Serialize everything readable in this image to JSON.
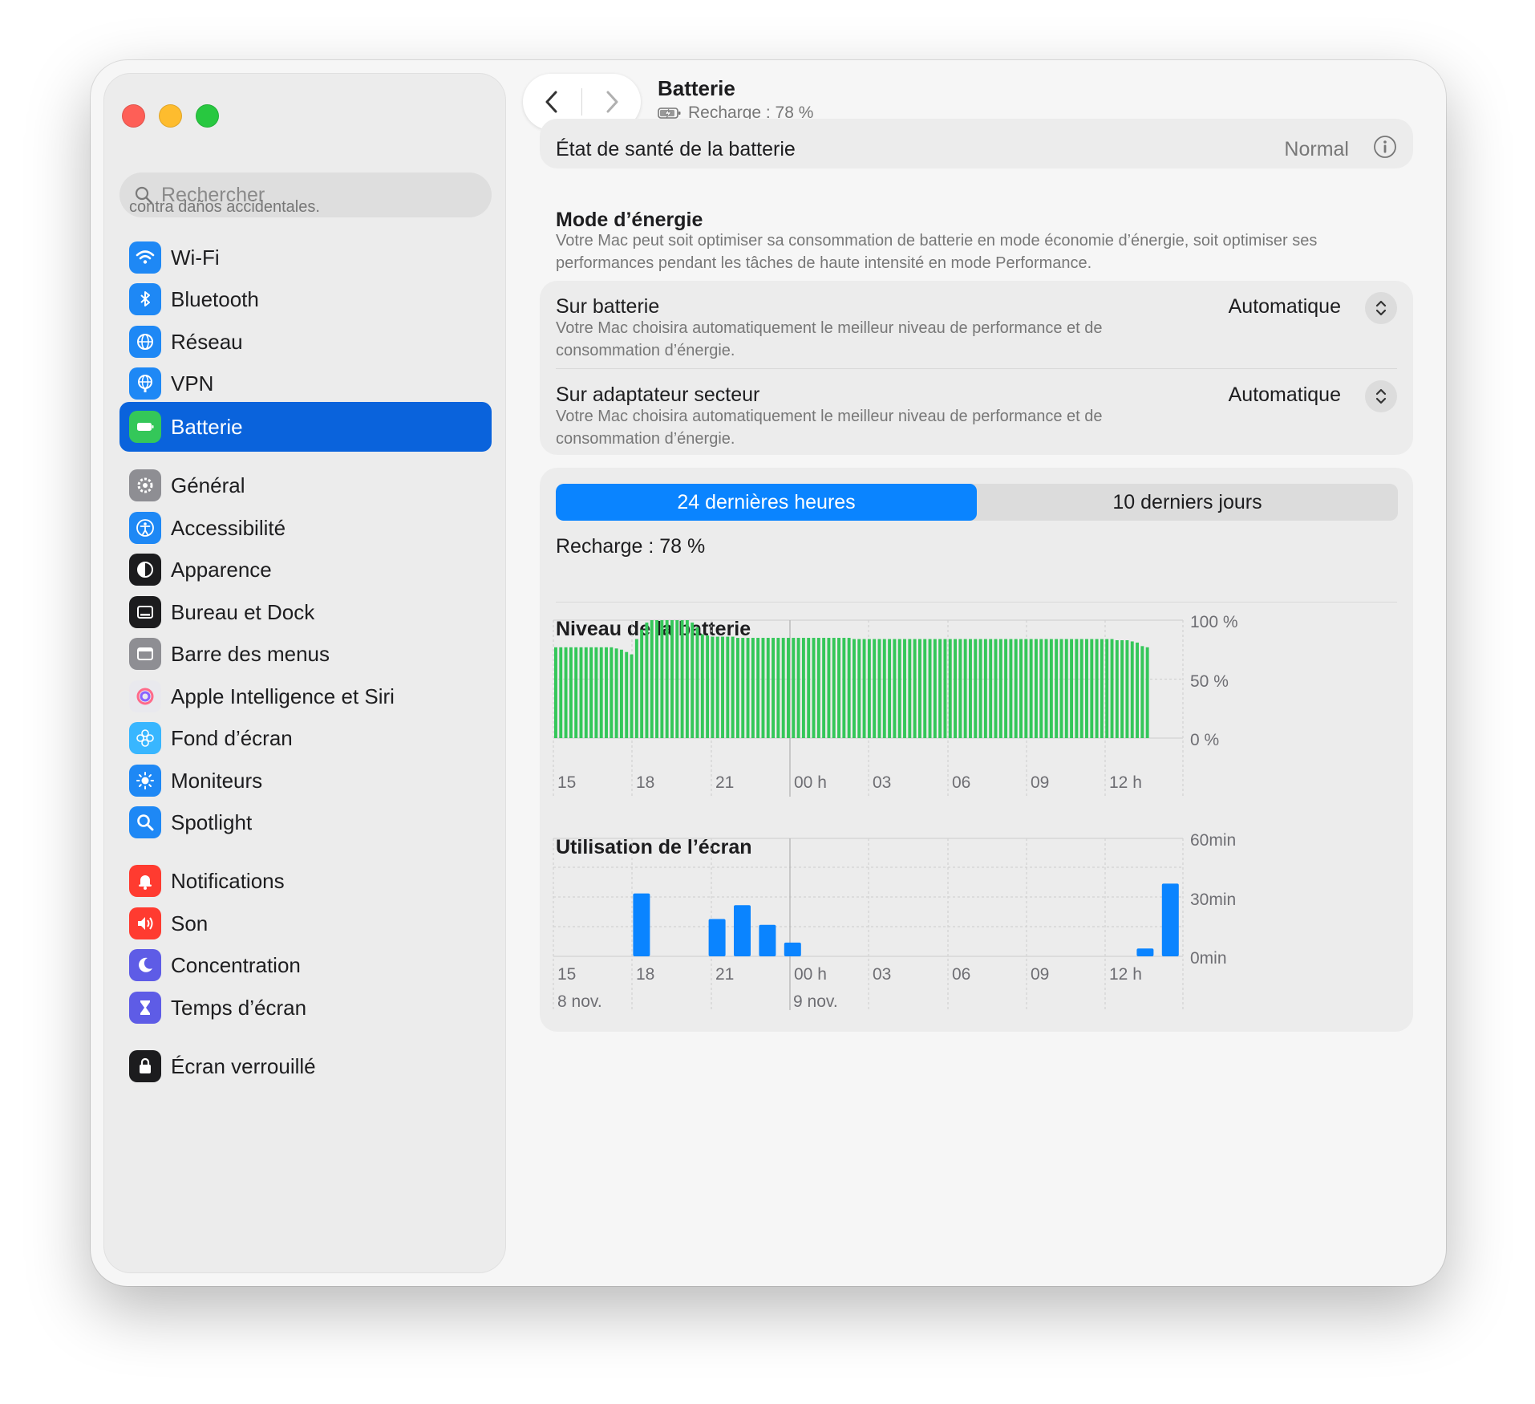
{
  "sidebar": {
    "search_placeholder": "Rechercher",
    "ghost_text": "contra daños accidentales.",
    "items": [
      {
        "label": "Wi-Fi",
        "icon": "wifi-icon",
        "color": "#1e88f5"
      },
      {
        "label": "Bluetooth",
        "icon": "bluetooth-icon",
        "color": "#1e88f5"
      },
      {
        "label": "Réseau",
        "icon": "globe-icon",
        "color": "#1e88f5"
      },
      {
        "label": "VPN",
        "icon": "vpn-globe-icon",
        "color": "#1e88f5"
      },
      {
        "label": "Batterie",
        "icon": "battery-icon",
        "color": "#34c759",
        "active": true
      },
      {
        "label": "Général",
        "icon": "gear-icon",
        "color": "#8e8e93"
      },
      {
        "label": "Accessibilité",
        "icon": "accessibility-icon",
        "color": "#1e88f5"
      },
      {
        "label": "Apparence",
        "icon": "appearance-icon",
        "color": "#1c1c1e"
      },
      {
        "label": "Bureau et Dock",
        "icon": "dock-icon",
        "color": "#1c1c1e"
      },
      {
        "label": "Barre des menus",
        "icon": "menubar-icon",
        "color": "#8e8e93"
      },
      {
        "label": "Apple Intelligence et Siri",
        "icon": "siri-icon",
        "color": "#e9e9ee"
      },
      {
        "label": "Fond d’écran",
        "icon": "flower-icon",
        "color": "#38b6ff"
      },
      {
        "label": "Moniteurs",
        "icon": "sun-icon",
        "color": "#1e88f5"
      },
      {
        "label": "Spotlight",
        "icon": "magnifier-icon",
        "color": "#1e88f5"
      },
      {
        "label": "Notifications",
        "icon": "bell-icon",
        "color": "#ff3b30"
      },
      {
        "label": "Son",
        "icon": "speaker-icon",
        "color": "#ff3b30"
      },
      {
        "label": "Concentration",
        "icon": "moon-icon",
        "color": "#5e5ce6"
      },
      {
        "label": "Temps d’écran",
        "icon": "hourglass-icon",
        "color": "#5e5ce6"
      },
      {
        "label": "Écran verrouillé",
        "icon": "lock-icon",
        "color": "#1c1c1e"
      }
    ]
  },
  "header": {
    "title": "Batterie",
    "subtitle": "Recharge : 78 %"
  },
  "health": {
    "label": "État de santé de la batterie",
    "value": "Normal"
  },
  "energy": {
    "title": "Mode d’énergie",
    "description": "Votre Mac peut soit optimiser sa consommation de batterie en mode économie d’énergie, soit optimiser ses performances pendant les tâches de haute intensité en mode Performance.",
    "rows": [
      {
        "title": "Sur batterie",
        "description": "Votre Mac choisira automatiquement le meilleur niveau de performance et de consommation d’énergie.",
        "value": "Automatique"
      },
      {
        "title": "Sur adaptateur secteur",
        "description": "Votre Mac choisira automatiquement le meilleur niveau de performance et de consommation d’énergie.",
        "value": "Automatique"
      }
    ]
  },
  "usage": {
    "tabs": [
      "24 dernières heures",
      "10 derniers jours"
    ],
    "active_tab": 0,
    "recharge": "Recharge : 78 %"
  },
  "chart_data": [
    {
      "type": "bar",
      "title": "Niveau de la batterie",
      "x_tick_labels": [
        "15",
        "18",
        "21",
        "00 h",
        "03",
        "06",
        "09",
        "12 h"
      ],
      "y_tick_labels": [
        "100 %",
        "50 %",
        "0 %"
      ],
      "ylim": [
        0,
        100
      ],
      "unit": "%",
      "color": "#34c759",
      "values": [
        77,
        77,
        77,
        77,
        77,
        77,
        77,
        77,
        77,
        77,
        77,
        77,
        76,
        75,
        73,
        71,
        84,
        92,
        98,
        100,
        100,
        100,
        100,
        100,
        100,
        100,
        100,
        98,
        94,
        88,
        87,
        86,
        86,
        86,
        86,
        86,
        85,
        85,
        85,
        85,
        85,
        85,
        85,
        85,
        85,
        85,
        85,
        85,
        85,
        85,
        85,
        85,
        85,
        85,
        85,
        85,
        85,
        85,
        85,
        84,
        84,
        84,
        84,
        84,
        84,
        84,
        84,
        84,
        84,
        84,
        84,
        84,
        84,
        84,
        84,
        84,
        84,
        84,
        84,
        84,
        84,
        84,
        84,
        84,
        84,
        84,
        84,
        84,
        84,
        84,
        84,
        84,
        84,
        84,
        84,
        84,
        84,
        84,
        84,
        84,
        84,
        84,
        84,
        84,
        84,
        84,
        84,
        84,
        84,
        84,
        84,
        83,
        83,
        83,
        82,
        81,
        78,
        77
      ]
    },
    {
      "type": "bar",
      "title": "Utilisation de l’écran",
      "x_tick_labels": [
        "15",
        "18",
        "21",
        "00 h",
        "03",
        "06",
        "09",
        "12 h"
      ],
      "date_labels": [
        "8 nov.",
        "9 nov."
      ],
      "y_tick_labels": [
        "60min",
        "30min",
        "0min"
      ],
      "ylim": [
        0,
        60
      ],
      "unit": "min",
      "color": "#0a84ff",
      "hours": [
        "15",
        "16",
        "17",
        "18",
        "19",
        "20",
        "21",
        "22",
        "23",
        "00",
        "01",
        "02",
        "03",
        "04",
        "05",
        "06",
        "07",
        "08",
        "09",
        "10",
        "11",
        "12",
        "13",
        "14"
      ],
      "values": [
        0,
        0,
        0,
        32,
        0,
        0,
        19,
        26,
        16,
        7,
        0,
        0,
        0,
        0,
        0,
        0,
        0,
        0,
        0,
        0,
        0,
        0,
        0,
        4,
        37
      ]
    }
  ]
}
